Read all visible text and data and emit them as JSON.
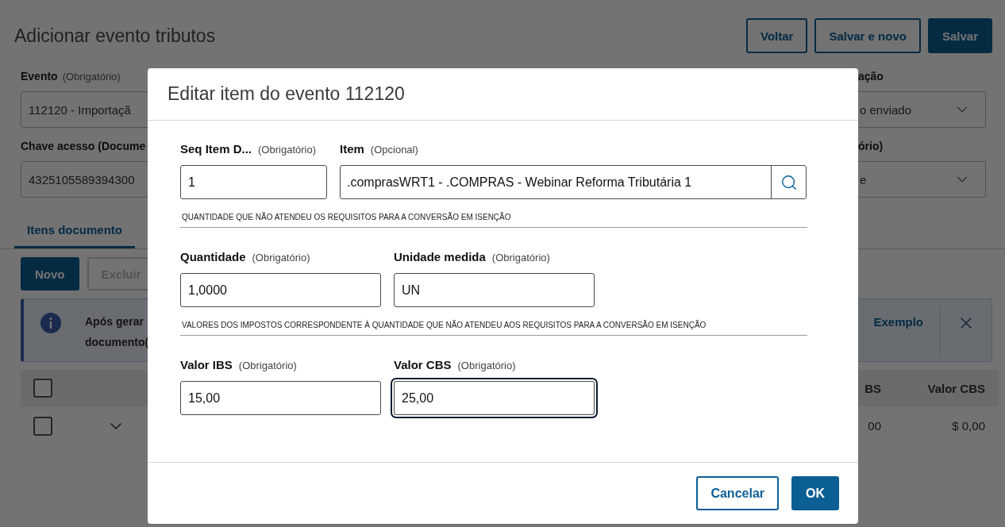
{
  "page": {
    "title": "Adicionar evento tributos",
    "actions": [
      {
        "label": "Voltar",
        "kind": "secondary"
      },
      {
        "label": "Salvar e novo",
        "kind": "secondary"
      },
      {
        "label": "Salvar",
        "kind": "primary"
      }
    ],
    "form_left": [
      {
        "label": "Evento",
        "hint": "(Obrigatório)",
        "value": "112120 - Importaçã"
      },
      {
        "label": "Chave acesso (Docume",
        "value": "4325105589394300"
      }
    ],
    "form_right": [
      {
        "label": "ação",
        "value": "o enviado"
      },
      {
        "label": "ório)",
        "value": "e"
      }
    ],
    "tabs": [
      {
        "label": "Itens documento",
        "selected": true
      }
    ],
    "toolbar": [
      {
        "label": "Novo",
        "kind": "primary",
        "disabled": false
      },
      {
        "label": "Excluir",
        "kind": "secondary",
        "disabled": true
      }
    ],
    "notice": {
      "lines": [
        "Após gerar",
        "documento("
      ],
      "link": "Exemplo"
    },
    "table": {
      "all_checked": false,
      "columns": [
        "BS",
        "Valor CBS"
      ],
      "rows": [
        {
          "checked": false,
          "cells": [
            "00",
            "$ 0,00"
          ]
        }
      ]
    }
  },
  "dialog": {
    "title": "Editar item do evento 112120",
    "sections": [
      {
        "fields": [
          {
            "kind": "text",
            "label": "Seq Item D...",
            "hint": "(Obrigatório)",
            "value": "1",
            "focused": false
          },
          {
            "kind": "lookup",
            "label": "Item",
            "hint": "(Opcional)",
            "value": ".comprasWRT1 - .COMPRAS - Webinar Reforma Tributária 1",
            "focused": false
          }
        ],
        "caption": "QUANTIDADE QUE NÃO ATENDEU OS REQUISITOS PARA A CONVERSÃO EM ISENÇÃO"
      },
      {
        "fields": [
          {
            "kind": "text",
            "label": "Quantidade",
            "hint": "(Obrigatório)",
            "value": "1,0000",
            "focused": false
          },
          {
            "kind": "text",
            "label": "Unidade medida",
            "hint": "(Obrigatório)",
            "value": "UN",
            "focused": false
          }
        ],
        "caption": "VALORES DOS IMPOSTOS CORRESPONDENTE À QUANTIDADE QUE NÃO ATENDEU AOS REQUISITOS PARA A CONVERSÃO EM ISENÇÃO"
      },
      {
        "fields": [
          {
            "kind": "text",
            "label": "Valor IBS",
            "hint": "(Obrigatório)",
            "value": "15,00",
            "focused": false
          },
          {
            "kind": "text",
            "label": "Valor CBS",
            "hint": "(Obrigatório)",
            "value": "25,00",
            "focused": true
          }
        ]
      }
    ],
    "buttons": [
      {
        "label": "Cancelar",
        "kind": "secondary"
      },
      {
        "label": "OK",
        "kind": "primary"
      }
    ]
  }
}
